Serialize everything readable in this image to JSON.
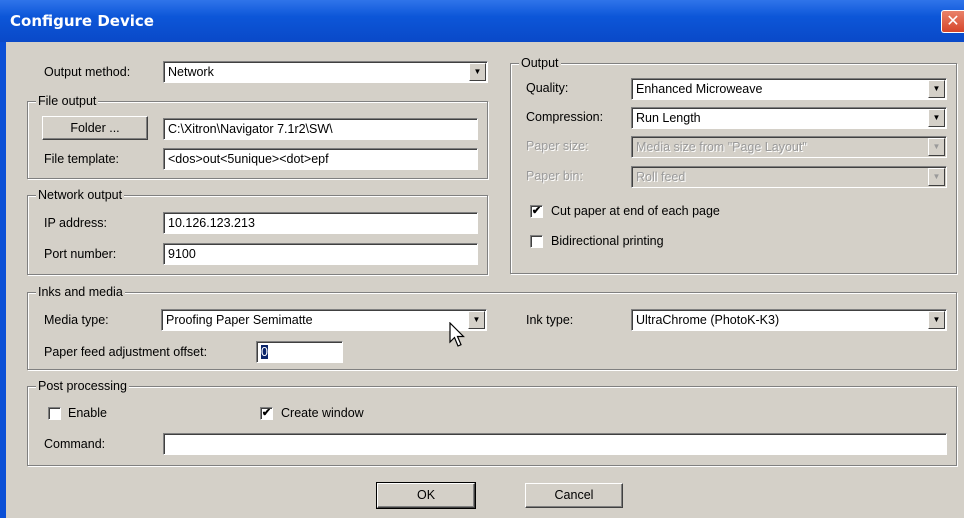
{
  "window": {
    "title": "Configure Device",
    "close_label": "✕"
  },
  "output_method": {
    "label": "Output method:",
    "value": "Network"
  },
  "file_output": {
    "legend": "File output",
    "folder_button": "Folder ...",
    "folder_path": "C:\\Xitron\\Navigator 7.1r2\\SW\\",
    "template_label": "File template:",
    "template_value": "<dos>out<5unique><dot>epf"
  },
  "network_output": {
    "legend": "Network output",
    "ip_label": "IP address:",
    "ip_value": "10.126.123.213",
    "port_label": "Port number:",
    "port_value": "9100"
  },
  "output": {
    "legend": "Output",
    "quality_label": "Quality:",
    "quality_value": "Enhanced Microweave",
    "compression_label": "Compression:",
    "compression_value": "Run Length",
    "paper_size_label": "Paper size:",
    "paper_size_value": "Media size from \"Page Layout\"",
    "paper_bin_label": "Paper bin:",
    "paper_bin_value": "Roll feed",
    "cut_paper_label": "Cut paper at end of each page",
    "cut_paper_checked": true,
    "bidirectional_label": "Bidirectional printing",
    "bidirectional_checked": false
  },
  "inks_media": {
    "legend": "Inks and media",
    "media_type_label": "Media type:",
    "media_type_value": "Proofing Paper Semimatte",
    "ink_type_label": "Ink type:",
    "ink_type_value": "UltraChrome (PhotoK-K3)",
    "feed_offset_label": "Paper feed adjustment offset:",
    "feed_offset_value": "0"
  },
  "post_processing": {
    "legend": "Post processing",
    "enable_label": "Enable",
    "enable_checked": false,
    "create_window_label": "Create window",
    "create_window_checked": true,
    "command_label": "Command:",
    "command_value": ""
  },
  "buttons": {
    "ok": "OK",
    "cancel": "Cancel"
  },
  "icons": {
    "dropdown": "▼",
    "check": "✔"
  }
}
